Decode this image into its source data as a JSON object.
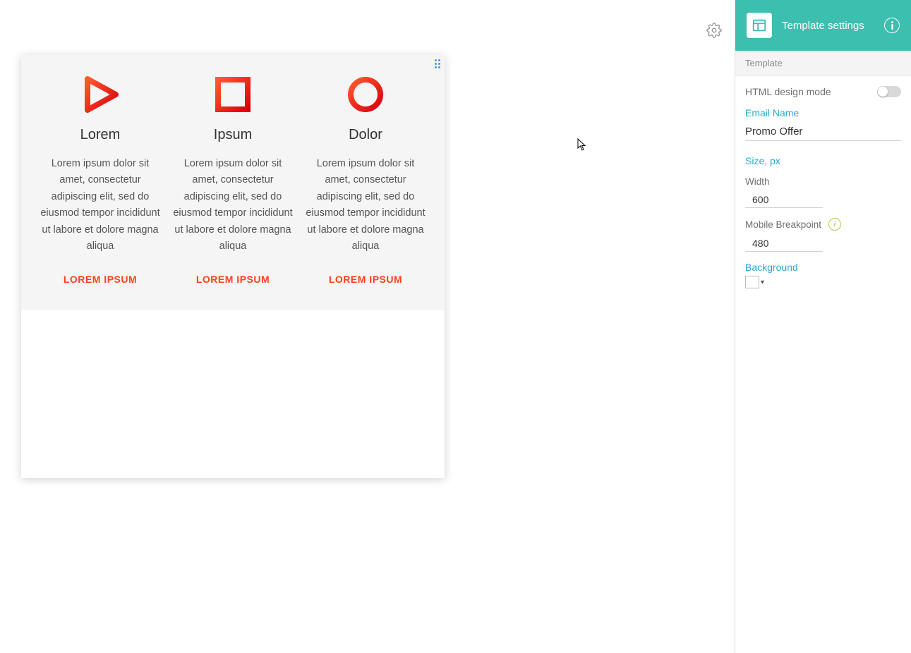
{
  "canvas": {
    "columns": [
      {
        "title": "Lorem",
        "body": "Lorem ipsum dolor sit amet, consectetur adipiscing elit, sed do eiusmod tempor incididunt ut labore et dolore magna aliqua",
        "cta": "LOREM IPSUM",
        "icon": "play-icon"
      },
      {
        "title": "Ipsum",
        "body": "Lorem ipsum dolor sit amet, consectetur adipiscing elit, sed do eiusmod tempor incididunt ut labore et dolore magna aliqua",
        "cta": "LOREM IPSUM",
        "icon": "square-icon"
      },
      {
        "title": "Dolor",
        "body": "Lorem ipsum dolor sit amet, consectetur adipiscing elit, sed do eiusmod tempor incididunt ut labore et dolore magna aliqua",
        "cta": "LOREM IPSUM",
        "icon": "circle-icon"
      }
    ]
  },
  "panel": {
    "header_title": "Template settings",
    "section_label": "Template",
    "html_mode_label": "HTML design mode",
    "email_name_label": "Email Name",
    "email_name_value": "Promo Offer",
    "size_label": "Size, px",
    "width_label": "Width",
    "width_value": "600",
    "breakpoint_label": "Mobile Breakpoint",
    "breakpoint_value": "480",
    "background_label": "Background",
    "background_color": "#ffffff"
  }
}
